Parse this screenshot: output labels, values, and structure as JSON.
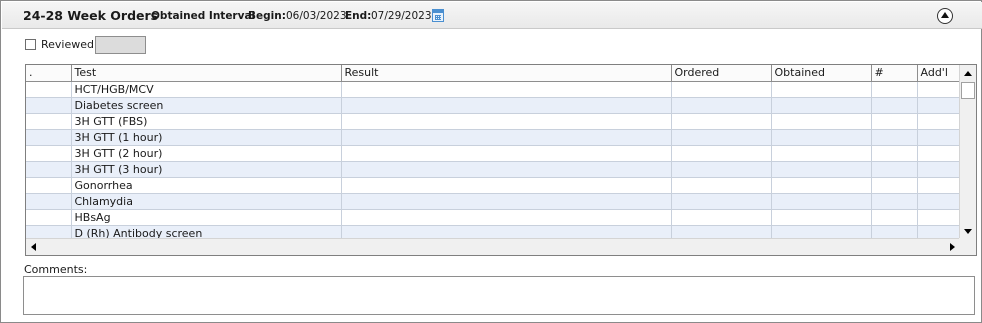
{
  "header": {
    "title": "24-28 Week Orders",
    "interval_label": "Obtained Interval",
    "begin_label": "Begin:",
    "begin_value": "06/03/2023",
    "end_label": "End:",
    "end_value": "07/29/2023",
    "calendar_icon": "calendar-icon",
    "collapse_icon": "collapse-up-icon"
  },
  "reviewed": {
    "label": "Reviewed",
    "checked": false,
    "value": ""
  },
  "grid": {
    "columns": [
      ".",
      "Test",
      "Result",
      "Ordered",
      "Obtained",
      "#",
      "Add'l"
    ],
    "rows": [
      {
        "test": "HCT/HGB/MCV"
      },
      {
        "test": "Diabetes screen"
      },
      {
        "test": "3H GTT (FBS)"
      },
      {
        "test": "3H GTT (1 hour)"
      },
      {
        "test": "3H GTT (2 hour)"
      },
      {
        "test": "3H GTT (3 hour)"
      },
      {
        "test": "Gonorrhea"
      },
      {
        "test": "Chlamydia"
      },
      {
        "test": "HBsAg"
      },
      {
        "test": "D (Rh) Antibody screen"
      }
    ]
  },
  "comments": {
    "label": "Comments:",
    "value": ""
  },
  "colors": {
    "row_alt": "#e9eff9",
    "header_bg": "#e9e9e9",
    "accent": "#4a8fd0"
  }
}
